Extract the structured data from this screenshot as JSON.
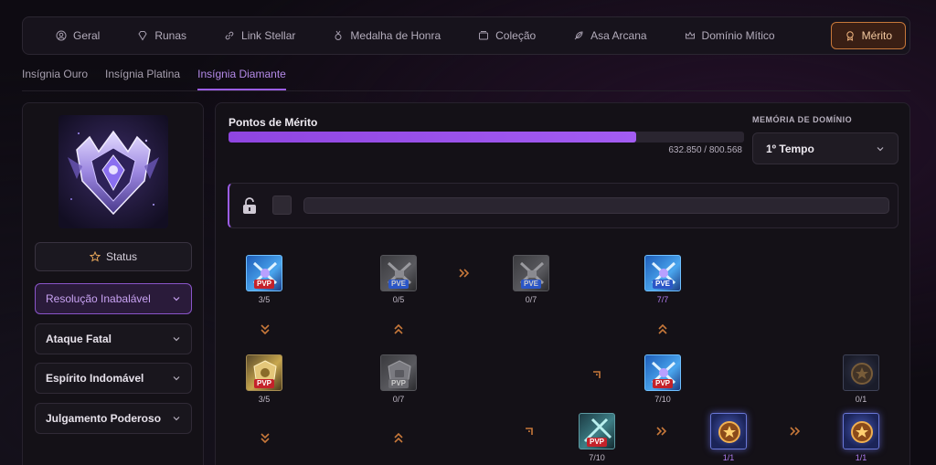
{
  "topnav": {
    "items": [
      {
        "label": "Geral",
        "icon": "user-circle-icon"
      },
      {
        "label": "Runas",
        "icon": "gem-icon"
      },
      {
        "label": "Link Stellar",
        "icon": "link-icon"
      },
      {
        "label": "Medalha de Honra",
        "icon": "medal-icon"
      },
      {
        "label": "Coleção",
        "icon": "collection-icon"
      },
      {
        "label": "Asa Arcana",
        "icon": "feather-icon"
      },
      {
        "label": "Domínio Mítico",
        "icon": "crown-icon"
      },
      {
        "label": "Mérito",
        "icon": "award-icon",
        "active": true
      }
    ]
  },
  "subtabs": {
    "items": [
      {
        "label": "Insígnia Ouro"
      },
      {
        "label": "Insígnia Platina"
      },
      {
        "label": "Insígnia Diamante",
        "active": true
      }
    ]
  },
  "left": {
    "status_label": "Status",
    "accordion": [
      {
        "label": "Resolução Inabalável",
        "active": true
      },
      {
        "label": "Ataque Fatal"
      },
      {
        "label": "Espírito Indomável"
      },
      {
        "label": "Julgamento Poderoso"
      }
    ]
  },
  "merit": {
    "title": "Pontos de Mérito",
    "current": 632850,
    "max": 800568,
    "progress_text": "632.850 / 800.568",
    "progress_fraction": 0.79
  },
  "memory": {
    "label": "MEMÓRIA DE DOMÍNIO",
    "selected": "1º Tempo"
  },
  "nodes": [
    {
      "level": "3/5",
      "tag": "PVP",
      "style": "pvp-blue"
    },
    {
      "level": "0/5",
      "tag": "PVE",
      "style": "gray"
    },
    {
      "level": "0/7",
      "tag": "PVE",
      "style": "gray"
    },
    {
      "level": "7/7",
      "tag": "PVE",
      "style": "pve-blue",
      "full": true
    },
    {
      "level": "3/5",
      "tag": "PVP",
      "style": "gold"
    },
    {
      "level": "0/7",
      "tag": "PVP",
      "style": "gray"
    },
    {
      "level": "7/10",
      "tag": "PVP",
      "style": "pvp-blue"
    },
    {
      "level": "0/1",
      "tag": "",
      "style": "medal-dim"
    },
    {
      "level": "7/10",
      "tag": "PVP",
      "style": "teal"
    },
    {
      "level": "1/1",
      "tag": "",
      "style": "medal",
      "full": true
    },
    {
      "level": "1/1",
      "tag": "",
      "style": "medal",
      "full": true
    }
  ],
  "colors": {
    "accent_purple": "#9b5de5",
    "accent_orange": "#c7783a",
    "background": "#0e0b12"
  }
}
